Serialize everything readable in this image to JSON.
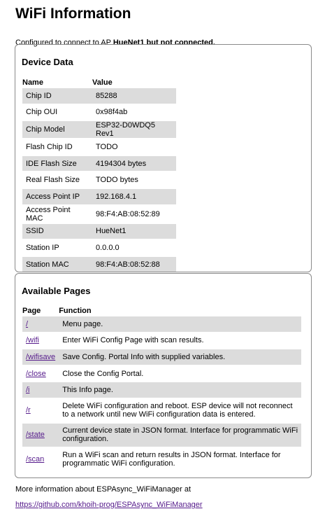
{
  "title": "WiFi Information",
  "status": {
    "prefix": "Configured to connect to AP ",
    "ap_name": "HueNet1",
    "suffix": " but not connected."
  },
  "device_data": {
    "heading": "Device Data",
    "col_name": "Name",
    "col_value": "Value",
    "rows": [
      {
        "name": "Chip ID",
        "value": "85288"
      },
      {
        "name": "Chip OUI",
        "value": "0x98f4ab"
      },
      {
        "name": "Chip Model",
        "value": "ESP32-D0WDQ5 Rev1"
      },
      {
        "name": "Flash Chip ID",
        "value": "TODO"
      },
      {
        "name": "IDE Flash Size",
        "value": "4194304 bytes"
      },
      {
        "name": "Real Flash Size",
        "value": "TODO bytes"
      },
      {
        "name": "Access Point IP",
        "value": "192.168.4.1"
      },
      {
        "name": "Access Point MAC",
        "value": "98:F4:AB:08:52:89"
      },
      {
        "name": "SSID",
        "value": "HueNet1"
      },
      {
        "name": "Station IP",
        "value": "0.0.0.0"
      },
      {
        "name": "Station MAC",
        "value": "98:F4:AB:08:52:88"
      }
    ]
  },
  "pages": {
    "heading": "Available Pages",
    "col_page": "Page",
    "col_function": "Function",
    "rows": [
      {
        "page": "/",
        "function": "Menu page."
      },
      {
        "page": "/wifi",
        "function": "Enter WiFi Config Page with scan results."
      },
      {
        "page": "/wifisave",
        "function": "Save Config. Portal Info with supplied variables."
      },
      {
        "page": "/close",
        "function": "Close the Config Portal."
      },
      {
        "page": "/i",
        "function": "This Info page."
      },
      {
        "page": "/r",
        "function": "Delete WiFi configuration and reboot. ESP device will not reconnect to a network until new WiFi configuration data is entered."
      },
      {
        "page": "/state",
        "function": "Current device state in JSON format. Interface for programmatic WiFi configuration."
      },
      {
        "page": "/scan",
        "function": "Run a WiFi scan and return results in JSON format. Interface for programmatic WiFi configuration."
      }
    ]
  },
  "footer": {
    "more_info": "More information about ESPAsync_WiFiManager at",
    "link": "https://github.com/khoih-prog/ESPAsync_WiFiManager"
  }
}
